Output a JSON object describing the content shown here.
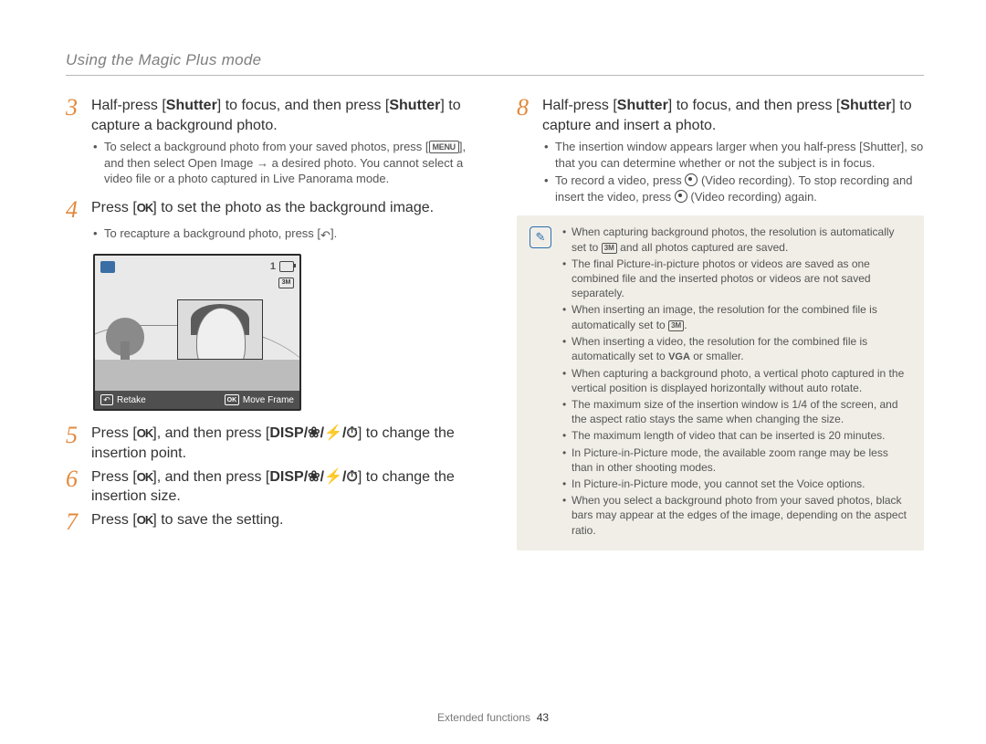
{
  "header": {
    "section_title": "Using the Magic Plus mode"
  },
  "left": {
    "s3": {
      "text_a": "Half-press [",
      "shutter1": "Shutter",
      "text_b": "] to focus, and then press [",
      "shutter2": "Shutter",
      "text_c": "] to capture a background photo.",
      "bullet_a1": "To select a background photo from your saved photos, press [",
      "bullet_a2": "], and then select ",
      "open_image": "Open Image",
      "bullet_a3": " → a desired photo. You cannot select a video file or a photo captured in Live Panorama mode.",
      "menu_label": "MENU"
    },
    "s4": {
      "text_a": "Press [",
      "text_b": "] to set the photo as the background image.",
      "bullet_a1": "To recapture a background photo, press [",
      "bullet_a2": "]."
    },
    "figure": {
      "retake": "Retake",
      "move": "Move Frame",
      "topnum": "1",
      "res": "3M"
    },
    "s5": {
      "text_a": "Press [",
      "text_b": "], and then press [",
      "text_c": "] to change the insertion point."
    },
    "s6": {
      "text_a": "Press [",
      "text_b": "], and then press [",
      "text_c": "] to change the insertion size."
    },
    "s7": {
      "text_a": "Press [",
      "text_b": "] to save the setting."
    },
    "tokens": {
      "ok": "OK",
      "disp_combo": "DISP/❀/⚡/⏱"
    }
  },
  "right": {
    "s8": {
      "text_a": "Half-press [",
      "shutter1": "Shutter",
      "text_b": "] to focus, and then press [",
      "shutter2": "Shutter",
      "text_c": "] to capture and insert a photo.",
      "bullet_a1": "The insertion window appears larger when you half-press [",
      "shutter3": "Shutter",
      "bullet_a2": "], so that you can determine whether or not the subject is in focus.",
      "bullet_b1": "To record a video, press ",
      "video_rec1": " (Video recording). To stop recording and insert the video, press ",
      "video_rec2": " (Video recording) again."
    },
    "notes": {
      "n1a": "When capturing background photos, the resolution is automatically set to ",
      "n1b": " and all photos captured are saved.",
      "n2": "The final Picture-in-picture photos or videos are saved as one combined file and the inserted photos or videos are not saved separately.",
      "n3a": "When inserting an image, the resolution for the combined file is automatically set to ",
      "n3b": ".",
      "n4a": "When inserting a video, the resolution for the combined file is automatically set to ",
      "n4b": " or smaller.",
      "n5": "When capturing a background photo, a vertical photo captured in the vertical position is displayed horizontally without auto rotate.",
      "n6": "The maximum size of the insertion window is 1/4 of the screen, and the aspect ratio stays the same when changing the size.",
      "n7": "The maximum length of video that can be inserted is 20 minutes.",
      "n8": "In Picture-in-Picture mode, the available zoom range may be less than in other shooting modes.",
      "n9": "In Picture-in-Picture mode, you cannot set the Voice options.",
      "n10": "When you select a background photo from your saved photos, black bars may appear at the edges of the image, depending on the aspect ratio.",
      "res3m": "3M",
      "vga": "VGA"
    }
  },
  "footer": {
    "section": "Extended functions",
    "page": "43"
  }
}
